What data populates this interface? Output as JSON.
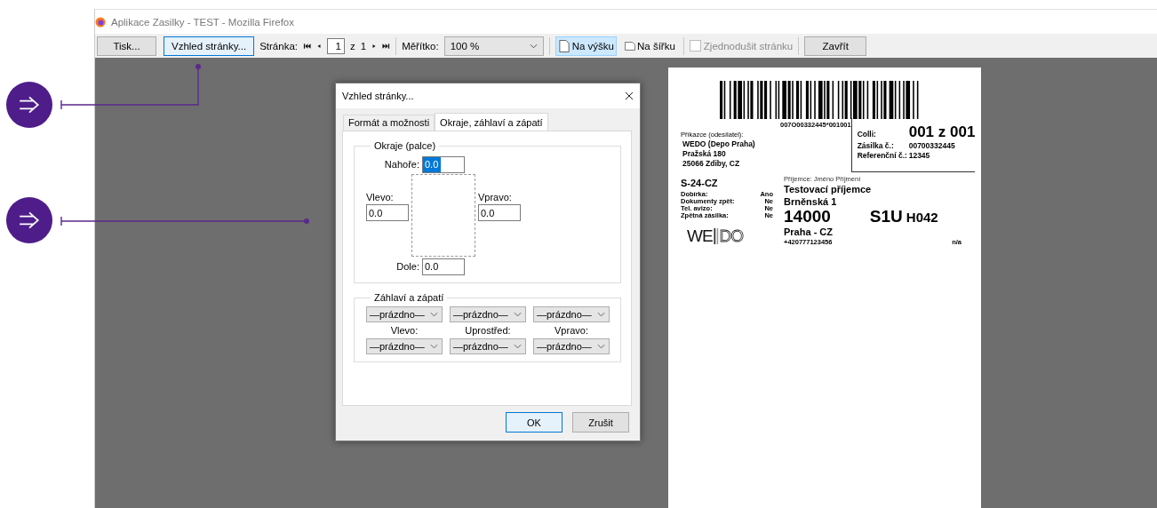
{
  "window": {
    "title": "Aplikace Zasilky - TEST - Mozilla Firefox"
  },
  "toolbar": {
    "print_button": "Tisk...",
    "page_setup_button": "Vzhled stránky...",
    "page_label": "Stránka:",
    "page_value": "1",
    "of_label": "z",
    "page_count": "1",
    "scale_label": "Měřítko:",
    "scale_value": "100 %",
    "orientations": [
      {
        "label": "Na výšku",
        "selected": true
      },
      {
        "label": "Na šířku",
        "selected": false
      }
    ],
    "simplify": {
      "label": "Zjednodušit stránku",
      "checked": false,
      "disabled": true
    },
    "close_button": "Zavřít"
  },
  "dialog": {
    "title": "Vzhled stránky...",
    "tabs": [
      {
        "label": "Formát a možnosti",
        "selected": false
      },
      {
        "label": "Okraje, záhlaví a zápatí",
        "selected": true
      }
    ],
    "margins": {
      "title": "Okraje (palce)",
      "top": {
        "label": "Nahoře:",
        "value": "0.0"
      },
      "left": {
        "label": "Vlevo:",
        "value": "0.0"
      },
      "right": {
        "label": "Vpravo:",
        "value": "0.0"
      },
      "bottom": {
        "label": "Dole:",
        "value": "0.0"
      }
    },
    "headers": {
      "title": "Záhlaví a zápatí",
      "header_selects": [
        "—prázdno—",
        "—prázdno—",
        "—prázdno—"
      ],
      "labels": [
        "Vlevo:",
        "Uprostřed:",
        "Vpravo:"
      ],
      "footer_selects": [
        "—prázdno—",
        "—prázdno—",
        "—prázdno—"
      ]
    },
    "buttons": [
      {
        "label": "OK",
        "default": true
      },
      {
        "label": "Zrušit",
        "default": false
      }
    ]
  },
  "label": {
    "barcode_text": "007O00332445*001001",
    "sender_label": "Příkazce (odesílatel):",
    "sender_lines": [
      "WEDO (Depo Praha)",
      "Pražská 180",
      "25066 Zdiby, CZ"
    ],
    "colli_label": "Colli:",
    "colli_value": "001 z 001",
    "shipment_label": "Zásilka č.:",
    "shipment_value": "00700332445",
    "reference_label": "Referenční č.:",
    "reference_value": "12345",
    "route": "S-24-CZ",
    "flags": [
      {
        "label": "Dobírka:",
        "value": "Ano"
      },
      {
        "label": "Dokumenty zpět:",
        "value": "Ne"
      },
      {
        "label": "Tel. avizo:",
        "value": "Ne"
      },
      {
        "label": "Zpětná zásilka:",
        "value": "Ne"
      }
    ],
    "logo_left": "WE",
    "logo_right": "DO",
    "recipient_label": "Příjemce: Jméno Příjmení",
    "recipient_name": "Testovací příjemce",
    "street": "Brněnská 1",
    "zip": "14000",
    "city": "Praha - CZ",
    "phone": "+420777123456",
    "sort_code": "S1U",
    "depot_code": "H042",
    "note": "n/a"
  }
}
